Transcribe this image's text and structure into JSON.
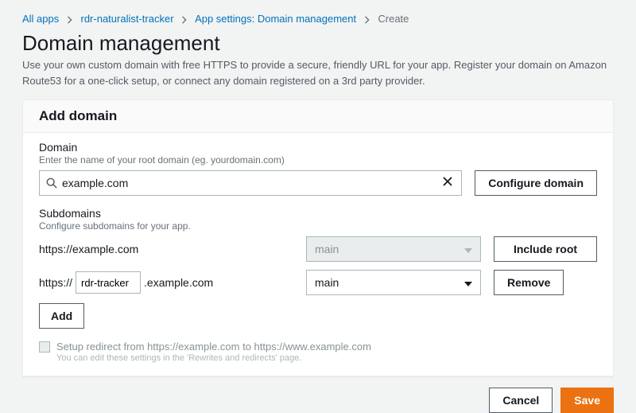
{
  "breadcrumbs": {
    "items": [
      {
        "label": "All apps",
        "link": true
      },
      {
        "label": "rdr-naturalist-tracker",
        "link": true
      },
      {
        "label": "App settings: Domain management",
        "link": true
      },
      {
        "label": "Create",
        "link": false
      }
    ]
  },
  "page": {
    "title": "Domain management",
    "subtext": "Use your own custom domain with free HTTPS to provide a secure, friendly URL for your app. Register your domain on Amazon Route53 for a one-click setup, or connect any domain registered on a 3rd party provider."
  },
  "panel": {
    "title": "Add domain"
  },
  "domain": {
    "label": "Domain",
    "hint": "Enter the name of your root domain (eg. yourdomain.com)",
    "value": "example.com",
    "configure_label": "Configure domain"
  },
  "subdomains": {
    "label": "Subdomains",
    "hint": "Configure subdomains for your app.",
    "rows": [
      {
        "url_prefix": "https://example.com",
        "subdomain_value": null,
        "url_suffix": "",
        "branch": "main",
        "branch_disabled": true,
        "action_label": "Include root"
      },
      {
        "url_prefix": "https://",
        "subdomain_value": "rdr-tracker",
        "url_suffix": ".example.com",
        "branch": "main",
        "branch_disabled": false,
        "action_label": "Remove"
      }
    ],
    "add_label": "Add"
  },
  "redirect": {
    "label": "Setup redirect from https://example.com to https://www.example.com",
    "sublabel": "You can edit these settings in the 'Rewrites and redirects' page."
  },
  "footer": {
    "cancel": "Cancel",
    "save": "Save"
  }
}
